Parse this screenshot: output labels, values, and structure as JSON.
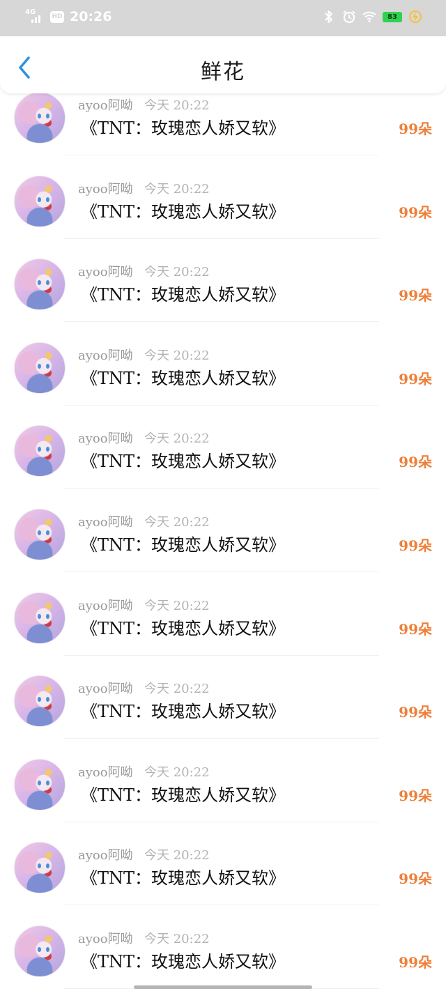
{
  "status_bar": {
    "network": "4G",
    "hd": "HD",
    "time": "20:26",
    "battery": "83",
    "icons": [
      "signal-icon",
      "hd-icon",
      "bluetooth-icon",
      "alarm-icon",
      "wifi-icon",
      "battery-icon",
      "charging-icon"
    ]
  },
  "header": {
    "title": "鲜花",
    "back_icon": "chevron-left-icon",
    "accent": "#2f8fe0"
  },
  "colors": {
    "count": "#ef7f38",
    "username": "#9a9a9a",
    "time": "#b3b3b3"
  },
  "list": [
    {
      "user": "ayoo阿呦",
      "time": "今天 20:22",
      "title": "《TNT：玫瑰恋人娇又软》",
      "count": "99朵"
    },
    {
      "user": "ayoo阿呦",
      "time": "今天 20:22",
      "title": "《TNT：玫瑰恋人娇又软》",
      "count": "99朵"
    },
    {
      "user": "ayoo阿呦",
      "time": "今天 20:22",
      "title": "《TNT：玫瑰恋人娇又软》",
      "count": "99朵"
    },
    {
      "user": "ayoo阿呦",
      "time": "今天 20:22",
      "title": "《TNT：玫瑰恋人娇又软》",
      "count": "99朵"
    },
    {
      "user": "ayoo阿呦",
      "time": "今天 20:22",
      "title": "《TNT：玫瑰恋人娇又软》",
      "count": "99朵"
    },
    {
      "user": "ayoo阿呦",
      "time": "今天 20:22",
      "title": "《TNT：玫瑰恋人娇又软》",
      "count": "99朵"
    },
    {
      "user": "ayoo阿呦",
      "time": "今天 20:22",
      "title": "《TNT：玫瑰恋人娇又软》",
      "count": "99朵"
    },
    {
      "user": "ayoo阿呦",
      "time": "今天 20:22",
      "title": "《TNT：玫瑰恋人娇又软》",
      "count": "99朵"
    },
    {
      "user": "ayoo阿呦",
      "time": "今天 20:22",
      "title": "《TNT：玫瑰恋人娇又软》",
      "count": "99朵"
    },
    {
      "user": "ayoo阿呦",
      "time": "今天 20:22",
      "title": "《TNT：玫瑰恋人娇又软》",
      "count": "99朵"
    },
    {
      "user": "ayoo阿呦",
      "time": "今天 20:22",
      "title": "《TNT：玫瑰恋人娇又软》",
      "count": "99朵"
    }
  ]
}
